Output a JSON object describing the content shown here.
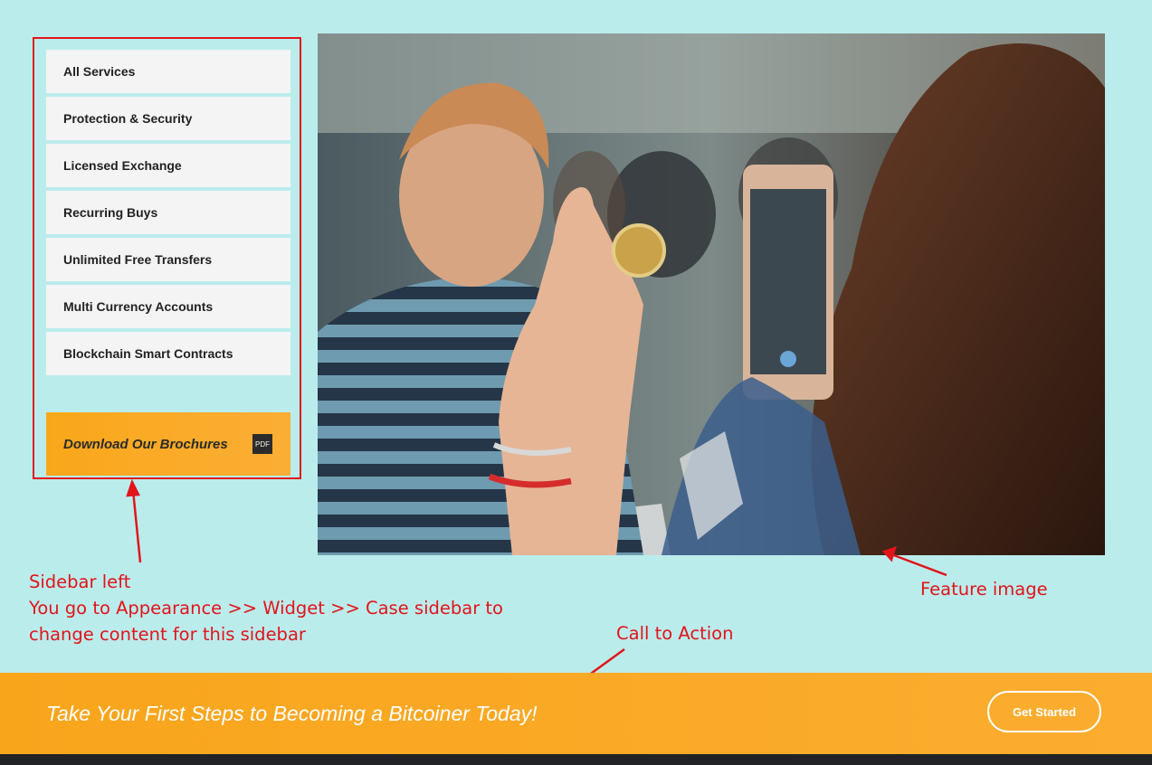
{
  "sidebar": {
    "items": [
      {
        "label": "All Services"
      },
      {
        "label": "Protection & Security"
      },
      {
        "label": "Licensed Exchange"
      },
      {
        "label": "Recurring Buys"
      },
      {
        "label": "Unlimited Free Transfers"
      },
      {
        "label": "Multi Currency Accounts"
      },
      {
        "label": "Blockchain Smart Contracts"
      }
    ],
    "brochure": {
      "label": "Download Our Brochures",
      "icon": "pdf-icon",
      "icon_text": "PDF"
    }
  },
  "annotations": {
    "sidebar_line1": "Sidebar left",
    "sidebar_line2": "You go to Appearance >> Widget >> Case sidebar to",
    "sidebar_line3": "change content for this sidebar",
    "feature": "Feature image",
    "cta": "Call to Action"
  },
  "cta": {
    "text": "Take Your First Steps to Becoming a Bitcoiner Today!",
    "button": "Get Started"
  },
  "colors": {
    "background": "#bbecec",
    "accent": "#f9a71a",
    "annotation": "#e0161b",
    "footer": "#222326"
  }
}
